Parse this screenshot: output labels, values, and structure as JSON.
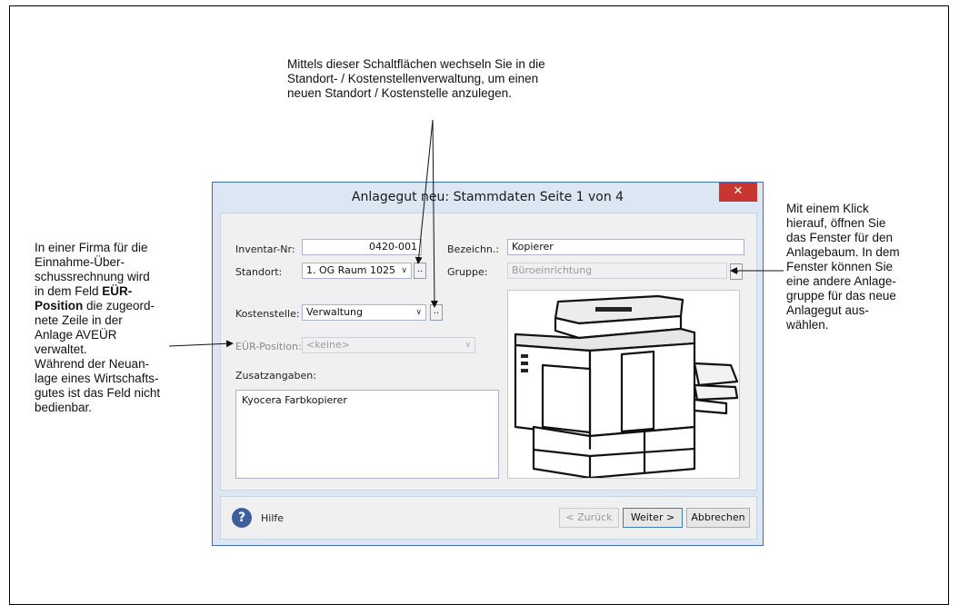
{
  "annotations": {
    "top": [
      "Mittels dieser Schaltflächen  wechseln Sie in die",
      "Standort- / Kostenstellenverwaltung,  um einen",
      "neuen Standort / Kostenstelle anzulegen."
    ],
    "left": {
      "line1": "In einer Firma für die",
      "line2": "Einnahme-Über-",
      "line3": "schussrechnung  wird",
      "line4_pre": "in dem Feld ",
      "line4_bold": "EÜR-",
      "line5_bold": "Position",
      "line5_post": " die zugeord-",
      "line6": "nete Zeile in der",
      "line7": "Anlage AVEÜR",
      "line8": "verwaltet.",
      "line9": "Während der Neuan-",
      "line10": "lage eines Wirtschafts-",
      "line11": "gutes ist das Feld nicht",
      "line12": "bedienbar."
    },
    "right": [
      "Mit einem Klick",
      "hierauf, öffnen Sie",
      "das Fenster für den",
      "Anlagebaum. In dem",
      "Fenster können Sie",
      "eine andere Anlage-",
      "gruppe für das neue",
      "Anlagegut aus-",
      "wählen."
    ]
  },
  "dialog": {
    "title": "Anlagegut neu: Stammdaten Seite 1 von 4",
    "close_label": "✕",
    "inventar_label": "Inventar-Nr:",
    "inventar_value": "0420-001",
    "bezeichnung_label": "Bezeichn.:",
    "bezeichnung_value": "Kopierer",
    "standort_label": "Standort:",
    "standort_value": "1. OG Raum 1025",
    "gruppe_label": "Gruppe:",
    "gruppe_value": "Büroeinrichtung",
    "kostenstelle_label": "Kostenstelle:",
    "kostenstelle_value": "Verwaltung",
    "eur_label": "EÜR-Position:",
    "eur_value": "<keine>",
    "zusatz_label": "Zusatzangaben:",
    "zusatz_value": "Kyocera Farbkopierer",
    "dots_label": "..",
    "chevron": "∨",
    "help_label": "Hilfe",
    "help_icon": "?",
    "back_label": "< Zurück",
    "next_label": "Weiter >",
    "cancel_label": "Abbrechen"
  },
  "icons": {
    "close": "close-icon",
    "help": "help-icon",
    "image": "copier-image"
  },
  "colors": {
    "dialog_border": "#3f6fb0",
    "titlebar": "#dde7f4",
    "close_button": "#c7372f",
    "help_icon": "#3e5f9b"
  }
}
